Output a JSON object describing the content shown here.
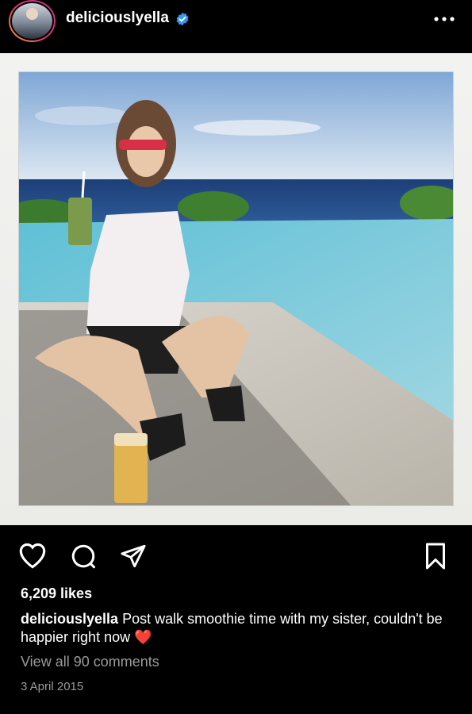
{
  "header": {
    "username": "deliciouslyella",
    "avatar_icon": "profile-avatar",
    "verified_icon": "verified-badge-icon",
    "more_icon": "more-options-icon"
  },
  "post": {
    "image_icon": "post-photo",
    "actions": {
      "like_icon": "heart-icon",
      "comment_icon": "comment-icon",
      "share_icon": "send-icon",
      "save_icon": "bookmark-icon"
    },
    "likes": "6,209 likes",
    "caption_user": "deliciouslyella",
    "caption_text": "Post walk smoothie time with my sister, couldn't be happier right now",
    "caption_emoji": "❤️",
    "view_comments": "View all 90 comments",
    "date": "3 April 2015"
  },
  "colors": {
    "background": "#000000",
    "text": "#ffffff",
    "muted": "#9a9a9a",
    "verified": "#3897f0",
    "heart": "#e0245e"
  }
}
